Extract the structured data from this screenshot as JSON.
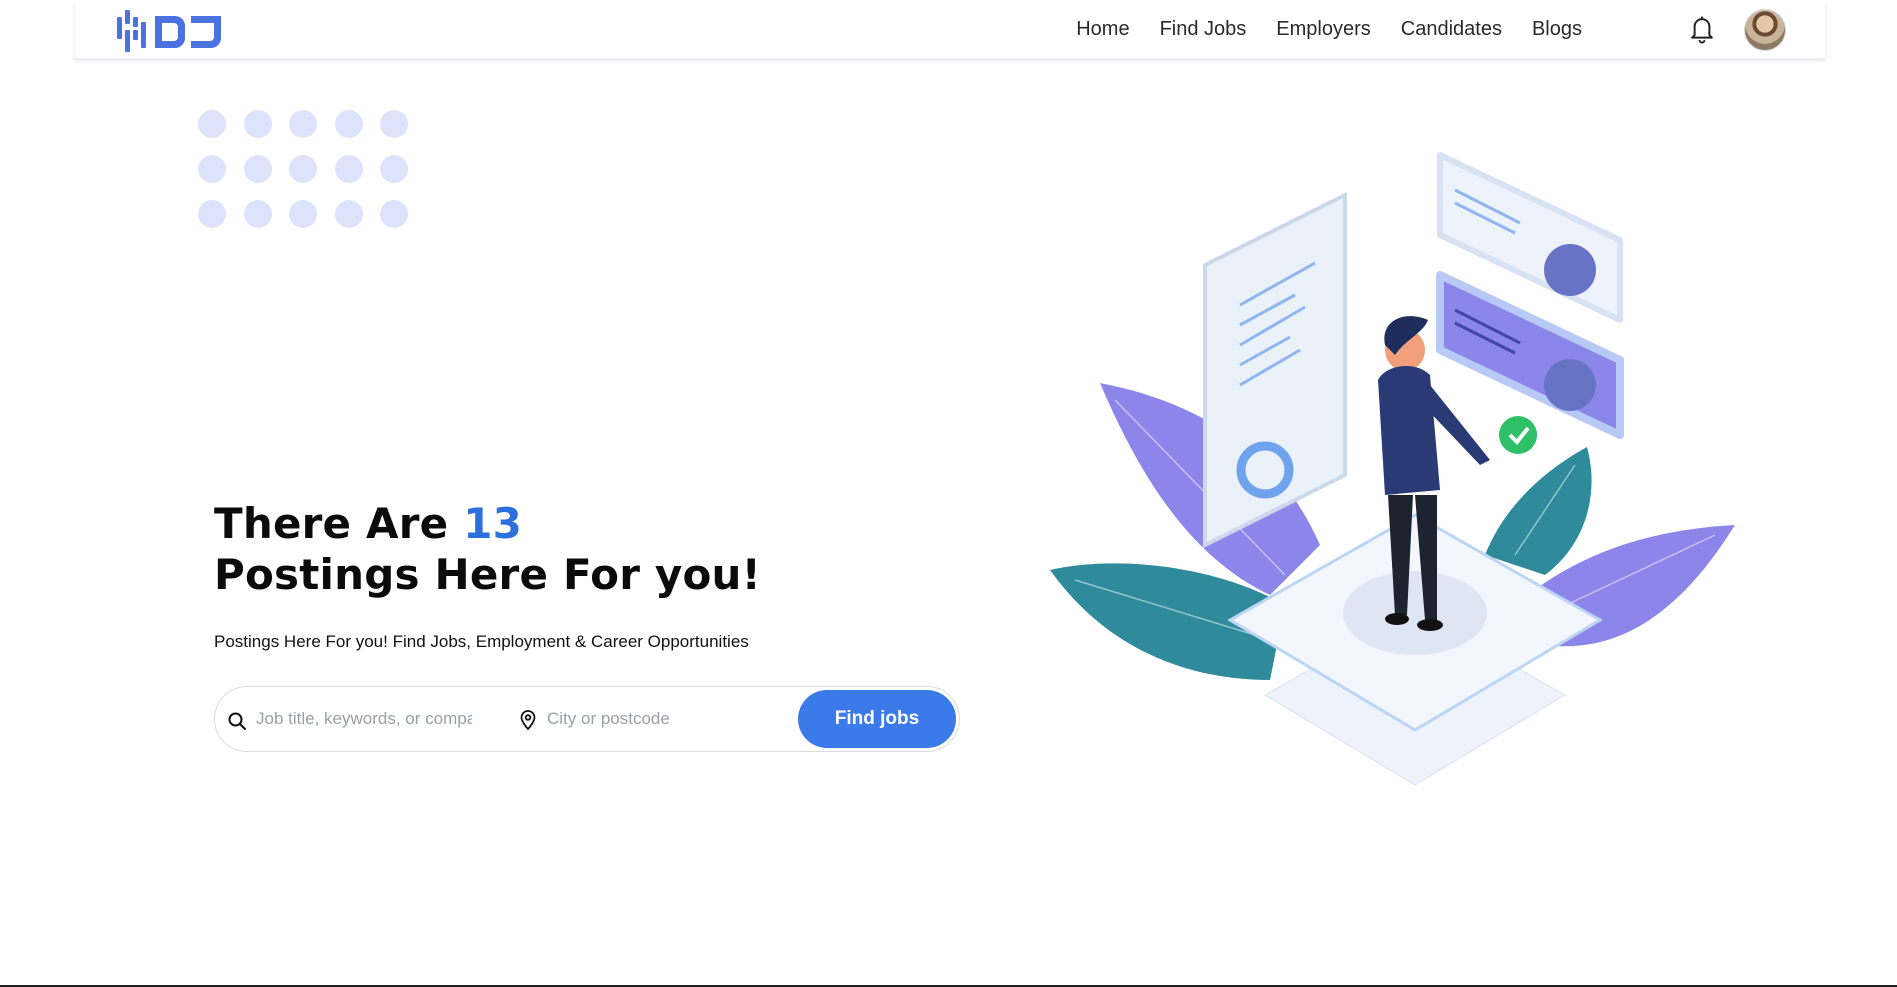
{
  "header": {
    "logo_icon": "hdj-logo",
    "nav": [
      {
        "label": "Home"
      },
      {
        "label": "Find Jobs"
      },
      {
        "label": "Employers"
      },
      {
        "label": "Candidates"
      },
      {
        "label": "Blogs"
      }
    ],
    "notification_icon": "bell-icon",
    "avatar_icon": "user-avatar"
  },
  "hero": {
    "title_line1_prefix": "There Are ",
    "title_count": "13",
    "title_line2": "Postings Here For you!",
    "subtitle": "Postings Here For you! Find Jobs, Employment & Career Opportunities"
  },
  "search": {
    "keyword_placeholder": "Job title, keywords, or company",
    "keyword_value": "",
    "location_placeholder": "City or postcode",
    "location_value": "",
    "button_label": "Find jobs"
  },
  "colors": {
    "accent": "#3b7be9",
    "title_accent": "#2d6fdc",
    "dot": "#dde3fb",
    "leaf_purple": "#8c86ea",
    "leaf_teal": "#2f8a9b"
  }
}
